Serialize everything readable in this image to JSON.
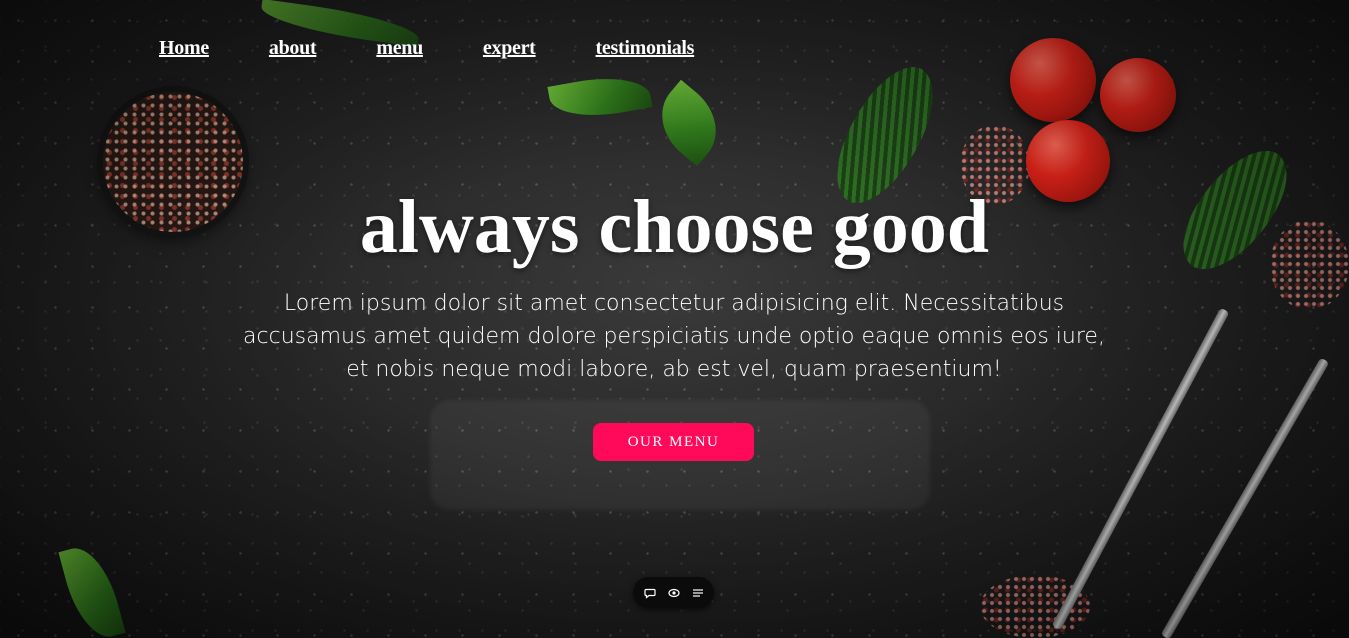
{
  "nav": {
    "items": [
      {
        "label": "Home"
      },
      {
        "label": "about"
      },
      {
        "label": "menu"
      },
      {
        "label": "expert"
      },
      {
        "label": "testimonials"
      }
    ]
  },
  "hero": {
    "title": "always choose good",
    "text": "Lorem ipsum dolor sit amet consectetur adipisicing elit. Necessitatibus accusamus amet quidem dolore perspiciatis unde optio eaque omnis eos iure, et nobis neque modi labore, ab est vel, quam praesentium!",
    "cta_label": "OUR MENU",
    "background_image": "dark stone table with tomatoes, basil leaves, herbs, peppercorn bowl and forks"
  },
  "floating_toolbar": {
    "icons": [
      "comment-icon",
      "eye-icon",
      "list-icon"
    ]
  },
  "colors": {
    "accent": "#ff0a5a",
    "text": "#ffffff",
    "background": "#1b1b1b"
  }
}
